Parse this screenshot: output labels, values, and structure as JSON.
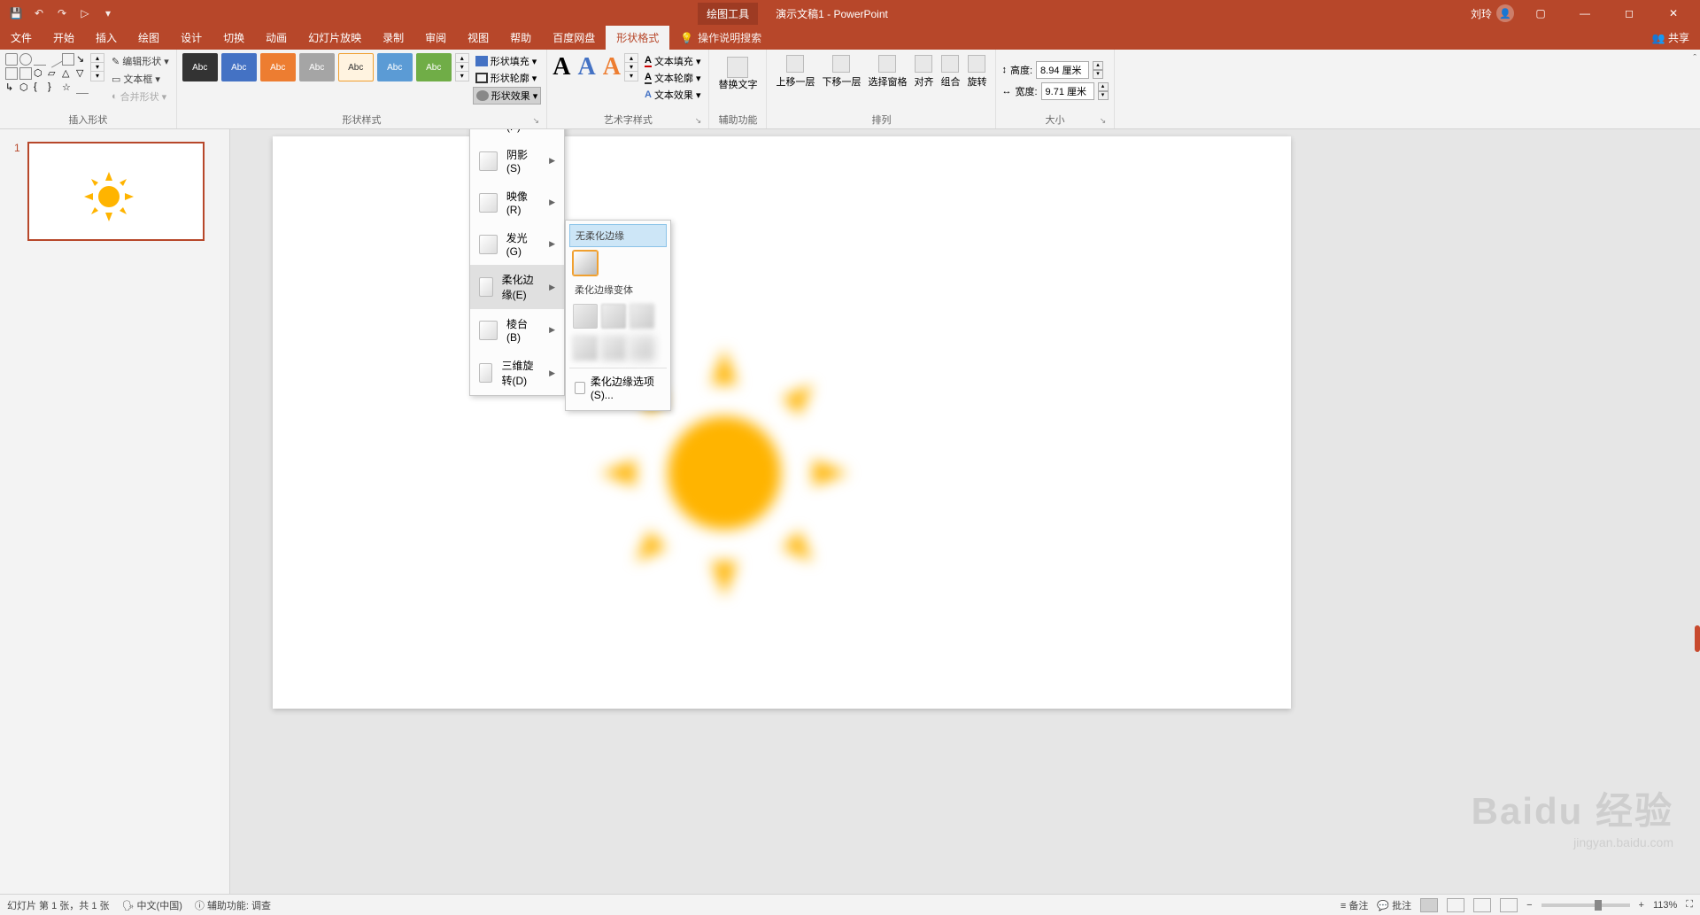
{
  "titlebar": {
    "context_tab": "绘图工具",
    "title": "演示文稿1 - PowerPoint",
    "user": "刘玲"
  },
  "tabs": {
    "file": "文件",
    "home": "开始",
    "insert": "插入",
    "draw": "绘图",
    "design": "设计",
    "transitions": "切换",
    "animations": "动画",
    "slideshow": "幻灯片放映",
    "record": "录制",
    "review": "审阅",
    "view": "视图",
    "help": "帮助",
    "baidu": "百度网盘",
    "format": "形状格式",
    "tellme": "操作说明搜索",
    "share": "共享"
  },
  "ribbon": {
    "insert_shapes": {
      "label": "插入形状",
      "edit": "编辑形状",
      "textbox": "文本框",
      "merge": "合并形状"
    },
    "shape_styles": {
      "label": "形状样式",
      "fill": "形状填充",
      "outline": "形状轮廓",
      "effects": "形状效果",
      "abc": "Abc"
    },
    "wordart": {
      "label": "艺术字样式",
      "text_fill": "文本填充",
      "text_outline": "文本轮廓",
      "text_effects": "文本效果"
    },
    "accessibility": {
      "label": "辅助功能",
      "alt": "替换文字"
    },
    "arrange": {
      "label": "排列",
      "bring_forward": "上移一层",
      "send_backward": "下移一层",
      "selection_pane": "选择窗格",
      "align": "对齐",
      "group": "组合",
      "rotate": "旋转"
    },
    "size": {
      "label": "大小",
      "height_label": "高度:",
      "width_label": "宽度:",
      "height": "8.94 厘米",
      "width": "9.71 厘米"
    }
  },
  "effects_menu": {
    "preset": "预设(P)",
    "shadow": "阴影(S)",
    "reflection": "映像(R)",
    "glow": "发光(G)",
    "soft_edges": "柔化边缘(E)",
    "bevel": "棱台(B)",
    "rotation_3d": "三维旋转(D)"
  },
  "soft_edges_submenu": {
    "none": "无柔化边缘",
    "variants": "柔化边缘变体",
    "options": "柔化边缘选项(S)..."
  },
  "thumbs": {
    "slide1_num": "1"
  },
  "statusbar": {
    "slide_info": "幻灯片 第 1 张，共 1 张",
    "language": "中文(中国)",
    "accessibility": "辅助功能: 调查",
    "notes": "备注",
    "comments": "批注",
    "zoom": "113%"
  },
  "watermark": {
    "logo": "Baidu 经验",
    "sub": "jingyan.baidu.com"
  }
}
